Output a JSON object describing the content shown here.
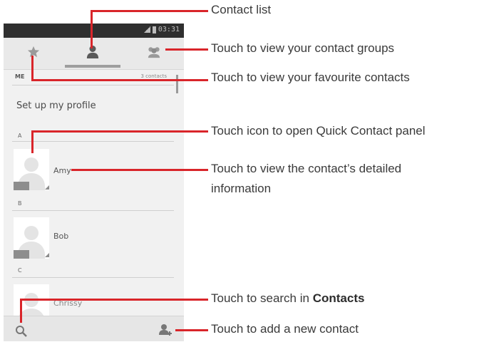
{
  "status_bar": {
    "time": "03:31"
  },
  "tabs": [
    {
      "name": "favourites",
      "icon": "star-icon"
    },
    {
      "name": "contacts",
      "icon": "person-icon"
    },
    {
      "name": "groups",
      "icon": "group-icon"
    }
  ],
  "me": {
    "label": "ME",
    "count": "3 contacts"
  },
  "profile": {
    "label": "Set up my profile"
  },
  "sections": [
    {
      "letter": "A",
      "contact": "Amy"
    },
    {
      "letter": "B",
      "contact": "Bob"
    },
    {
      "letter": "C",
      "contact": "Chrissy"
    }
  ],
  "bottom_bar": {
    "search_icon": "search-icon",
    "add_icon": "add-contact-icon"
  },
  "annotations": {
    "contact_list": "Contact list",
    "groups": "Touch to view your contact groups",
    "favourites": "Touch to view your favourite contacts",
    "quick_contact": "Touch icon to open Quick Contact panel",
    "details_line1": "Touch to view the contact’s detailed",
    "details_line2": "information",
    "search_prefix": "Touch to search in ",
    "search_bold": "Contacts",
    "add": "Touch to add a new contact"
  },
  "colors": {
    "accent": "#d9252a",
    "statusbar": "#2f2f2f",
    "screen": "#f1f1f1"
  }
}
